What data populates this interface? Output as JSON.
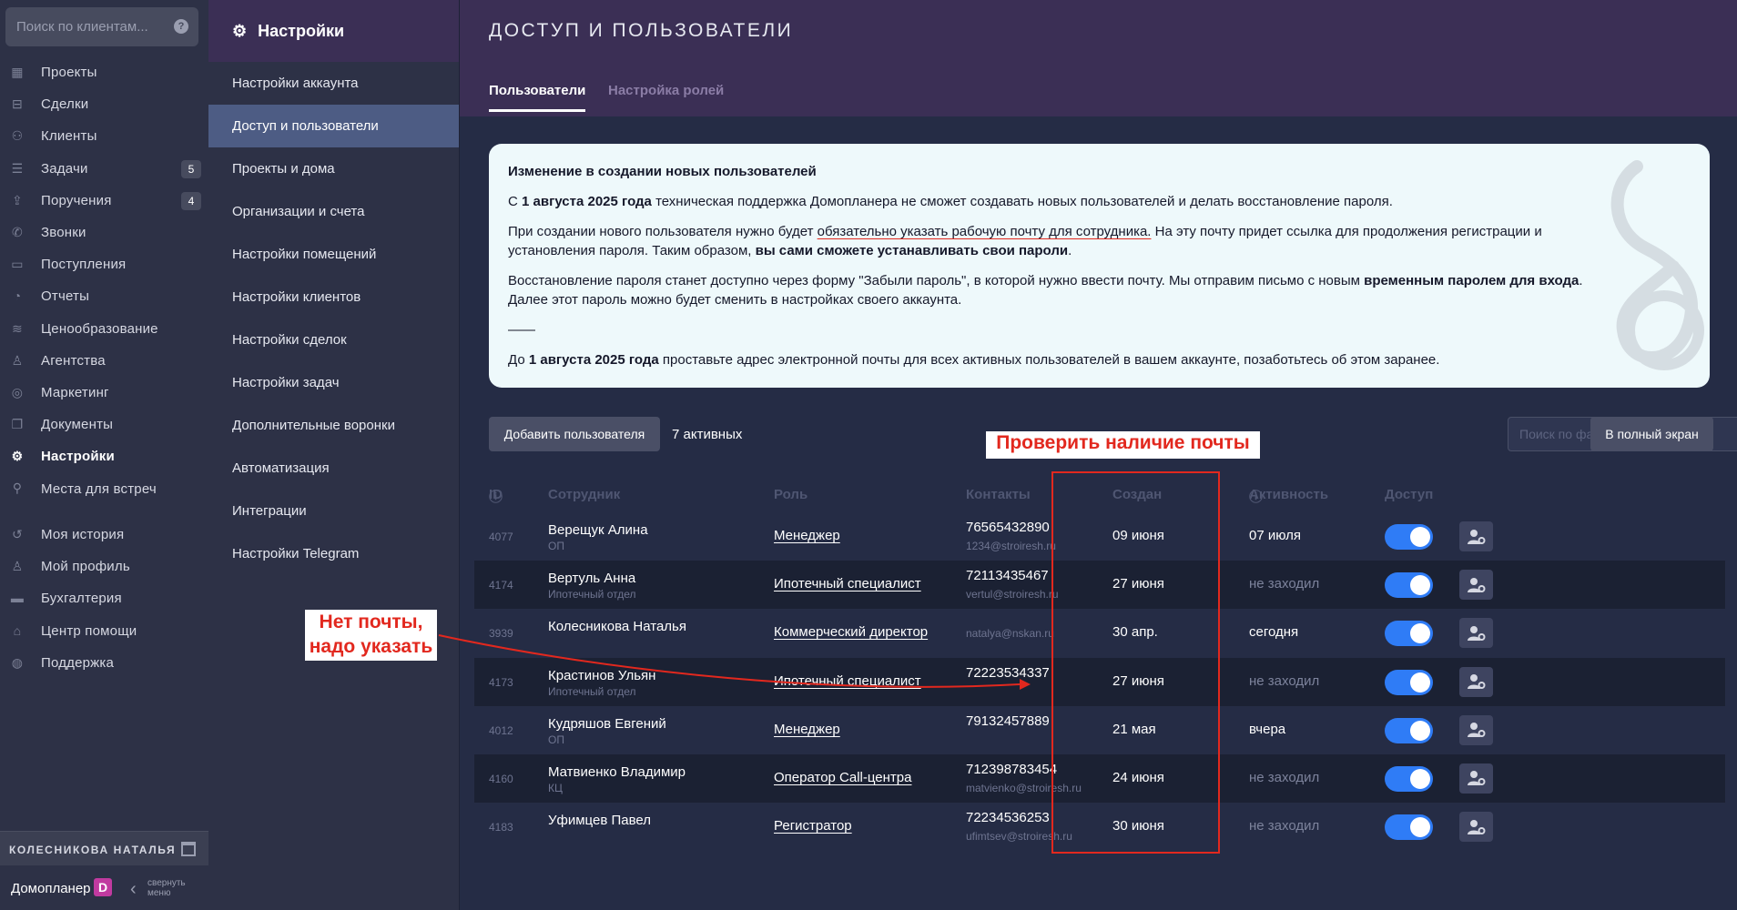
{
  "sidebar": {
    "search_placeholder": "Поиск по клиентам...",
    "items": [
      {
        "label": "Проекты",
        "icon": "grid-icon",
        "badge": ""
      },
      {
        "label": "Сделки",
        "icon": "deals-icon",
        "badge": ""
      },
      {
        "label": "Клиенты",
        "icon": "users-icon",
        "badge": ""
      },
      {
        "label": "Задачи",
        "icon": "tasks-icon",
        "badge": "5"
      },
      {
        "label": "Поручения",
        "icon": "assign-icon",
        "badge": "4"
      },
      {
        "label": "Звонки",
        "icon": "phone-icon",
        "badge": ""
      },
      {
        "label": "Поступления",
        "icon": "wallet-icon",
        "badge": ""
      },
      {
        "label": "Отчеты",
        "icon": "chart-icon",
        "badge": ""
      },
      {
        "label": "Ценообразование",
        "icon": "coins-icon",
        "badge": ""
      },
      {
        "label": "Агентства",
        "icon": "agency-icon",
        "badge": ""
      },
      {
        "label": "Маркетинг",
        "icon": "target-icon",
        "badge": ""
      },
      {
        "label": "Документы",
        "icon": "docs-icon",
        "badge": ""
      },
      {
        "label": "Настройки",
        "icon": "gear-icon",
        "badge": ""
      },
      {
        "label": "Места для встреч",
        "icon": "pin-icon",
        "badge": ""
      }
    ],
    "items2": [
      {
        "label": "Моя история",
        "icon": "history-icon"
      },
      {
        "label": "Мой профиль",
        "icon": "profile-icon"
      },
      {
        "label": "Бухгалтерия",
        "icon": "card-icon"
      },
      {
        "label": "Центр помощи",
        "icon": "hat-icon"
      },
      {
        "label": "Поддержка",
        "icon": "support-icon"
      }
    ],
    "user_name": "КОЛЕСНИКОВА НАТАЛЬЯ",
    "brand": "Домопланер",
    "brand_logo": "D",
    "collapse_label_1": "свернуть",
    "collapse_label_2": "меню"
  },
  "settings": {
    "title": "Настройки",
    "items": [
      "Настройки аккаунта",
      "Доступ и пользователи",
      "Проекты и дома",
      "Организации и счета",
      "Настройки помещений",
      "Настройки клиентов",
      "Настройки сделок",
      "Настройки задач",
      "Дополнительные воронки",
      "Автоматизация",
      "Интеграции",
      "Настройки Telegram"
    ]
  },
  "main": {
    "title": "ДОСТУП И ПОЛЬЗОВАТЕЛИ",
    "tabs": [
      "Пользователи",
      "Настройка ролей"
    ],
    "notice": {
      "heading": "Изменение в создании новых пользователей",
      "p1_a": "С ",
      "p1_b": "1 августа 2025 года",
      "p1_c": " техническая поддержка Домопланера не сможет создавать новых пользователей и делать восстановление пароля.",
      "p2_a": "При создании нового пользователя нужно будет ",
      "p2_u": "обязательно указать рабочую почту для сотрудника.",
      "p2_b": " На эту почту придет ссылка для продолжения регистрации и установления пароля. Таким образом, ",
      "p2_bold": "вы сами сможете устанавливать свои пароли",
      "p2_end": ".",
      "p3_a": "Восстановление пароля станет доступно через форму \"Забыли пароль\", в которой нужно ввести почту. Мы отправим письмо с новым ",
      "p3_bold": "временным паролем для входа",
      "p3_c": ". Далее этот пароль можно будет сменить в настройках своего аккаунта.",
      "sep": "——",
      "p4_a": "До ",
      "p4_bold": "1 августа 2025 года",
      "p4_c": " проставьте адрес электронной почты для всех активных пользователей в вашем аккаунте, позаботьтесь об этом заранее."
    },
    "add_button": "Добавить пользователя",
    "active_count": "7 активных",
    "search_placeholder": "Поиск по фамилии, отделу, роли",
    "fullscreen_button": "В полный экран",
    "annotation_check": "Проверить наличие почты",
    "annotation_missing_1": "Нет почты,",
    "annotation_missing_2": "надо указать"
  },
  "table": {
    "headers": {
      "id": "ID",
      "employee": "Сотрудник",
      "role": "Роль",
      "contacts": "Контакты",
      "created": "Создан",
      "activity": "Активность",
      "access": "Доступ"
    },
    "rows": [
      {
        "id": "4077",
        "name": "Верещук Алина",
        "dept": "ОП",
        "role": "Менеджер",
        "phone": "76565432890",
        "email": "1234@stroiresh.ru",
        "created": "09 июня",
        "activity": "07 июля",
        "activity_muted": false
      },
      {
        "id": "4174",
        "name": "Вертуль Анна",
        "dept": "Ипотечный отдел",
        "role": "Ипотечный специалист",
        "phone": "72113435467",
        "email": "vertul@stroiresh.ru",
        "created": "27 июня",
        "activity": "не заходил",
        "activity_muted": true
      },
      {
        "id": "3939",
        "name": "Колесникова Наталья",
        "dept": "",
        "role": "Коммерческий директор",
        "phone": "",
        "email": "natalya@nskan.ru",
        "created": "30 апр.",
        "activity": "сегодня",
        "activity_muted": false
      },
      {
        "id": "4173",
        "name": "Крастинов Ульян",
        "dept": "Ипотечный отдел",
        "role": "Ипотечный специалист",
        "phone": "72223534337",
        "email": "",
        "created": "27 июня",
        "activity": "не заходил",
        "activity_muted": true
      },
      {
        "id": "4012",
        "name": "Кудряшов Евгений",
        "dept": "ОП",
        "role": "Менеджер",
        "phone": "79132457889",
        "email": "",
        "created": "21 мая",
        "activity": "вчера",
        "activity_muted": false
      },
      {
        "id": "4160",
        "name": "Матвиенко Владимир",
        "dept": "КЦ",
        "role": "Оператор Call-центра",
        "phone": "712398783454",
        "email": "matvienko@stroiresh.ru",
        "created": "24 июня",
        "activity": "не заходил",
        "activity_muted": true
      },
      {
        "id": "4183",
        "name": "Уфимцев Павел",
        "dept": "",
        "role": "Регистратор",
        "phone": "72234536253",
        "email": "ufimtsev@stroiresh.ru",
        "created": "30 июня",
        "activity": "не заходил",
        "activity_muted": true
      }
    ]
  }
}
